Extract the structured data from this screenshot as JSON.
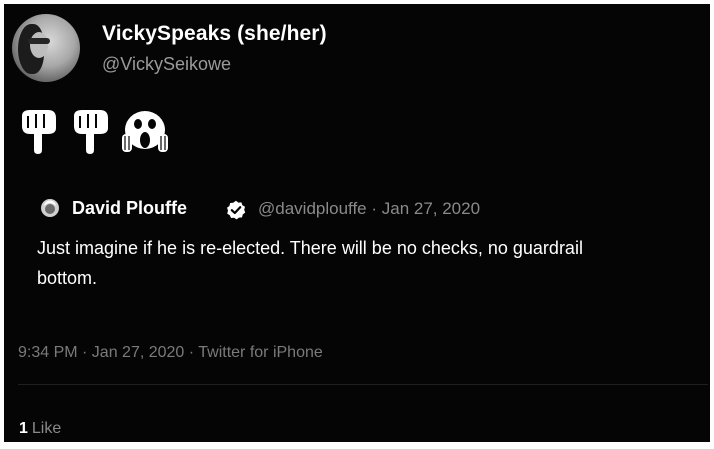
{
  "tweet": {
    "author": {
      "display_name": "VickySpeaks (she/her)",
      "handle": "@VickySeikowe",
      "avatar_icon": "profile-photo"
    },
    "emoji": [
      "backhand-index-pointing-down",
      "backhand-index-pointing-down",
      "face-screaming-in-fear"
    ],
    "quoted_tweet": {
      "author_name": "David Plouffe",
      "verified_icon": "verified-badge-icon",
      "meta": "@davidplouffe · Jan 27, 2020",
      "text_line_1": "Just imagine if he is re-elected. There will be no checks, no guardrail",
      "text_line_2": "bottom."
    },
    "timestamp": "9:34 PM · Jan 27, 2020 · Twitter for iPhone",
    "likes": {
      "count": "1",
      "label": "Like"
    }
  },
  "colors": {
    "background": "#050505",
    "text_primary": "#ffffff",
    "text_secondary": "#8a8a8a"
  }
}
